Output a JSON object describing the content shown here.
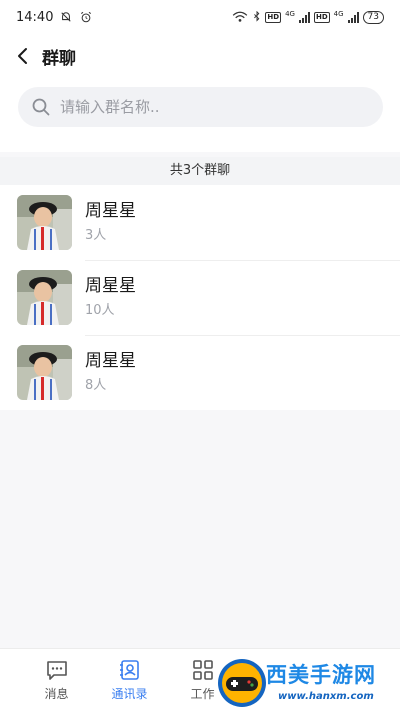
{
  "status_bar": {
    "time": "14:40",
    "net_4g_a": "4G",
    "net_4g_b": "4G",
    "hd_a": "HD",
    "hd_b": "HD",
    "battery": "73"
  },
  "header": {
    "title": "群聊"
  },
  "search": {
    "placeholder": "请输入群名称.."
  },
  "summary": {
    "text": "共3个群聊"
  },
  "groups": [
    {
      "name": "周星星",
      "members": "3人",
      "avatar": "group-avatar"
    },
    {
      "name": "周星星",
      "members": "10人",
      "avatar": "group-avatar"
    },
    {
      "name": "周星星",
      "members": "8人",
      "avatar": "group-avatar"
    }
  ],
  "bottom_nav": {
    "items": [
      {
        "label": "消息",
        "icon": "message-icon",
        "active": false
      },
      {
        "label": "通讯录",
        "icon": "contacts-icon",
        "active": true
      },
      {
        "label": "工作",
        "icon": "grid-icon",
        "active": false
      }
    ],
    "active_color": "#3b7ff0"
  },
  "watermark": {
    "text": "西美手游网",
    "url": "www.hanxm.com"
  }
}
